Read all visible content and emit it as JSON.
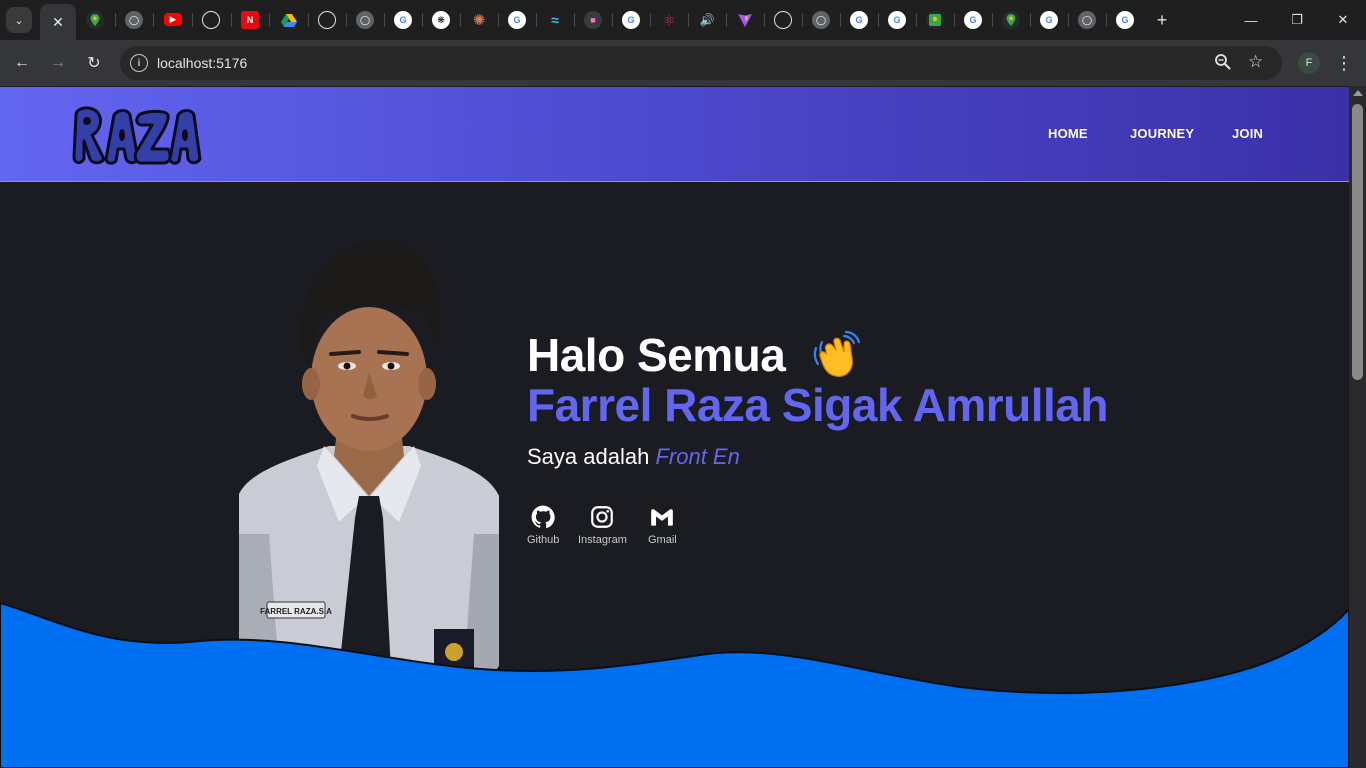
{
  "browser": {
    "url": "localhost:5176",
    "profile_initial": "F",
    "tab_favicons": [
      "google-maps-icon",
      "globe-icon",
      "youtube-icon",
      "github-icon",
      "netflix-icon",
      "google-drive-icon",
      "github-icon",
      "globe-icon",
      "google-icon",
      "openai-icon",
      "claude-icon",
      "google-icon",
      "tailwind-icon",
      "robot-icon",
      "google-icon",
      "react-icon",
      "speaker-icon",
      "vite-icon",
      "github-icon",
      "globe-icon",
      "google-icon",
      "google-icon",
      "google-maps-icon",
      "google-icon",
      "google-maps-icon",
      "google-icon",
      "globe-icon",
      "google-icon"
    ]
  },
  "navbar": {
    "logo_text": "RAZA",
    "links": [
      "HOME",
      "JOURNEY",
      "JOIN"
    ]
  },
  "hero": {
    "greeting": "Halo Semua",
    "name": "Farrel Raza Sigak Amrullah",
    "sub_prefix": "Saya adalah",
    "role_typed": "Front En"
  },
  "socials": [
    {
      "label": "Github",
      "icon": "github-icon"
    },
    {
      "label": "Instagram",
      "icon": "instagram-icon"
    },
    {
      "label": "Gmail",
      "icon": "gmail-icon"
    }
  ],
  "colors": {
    "accent": "#6366f1",
    "wave": "#0070f3",
    "background": "#1a1c22"
  }
}
